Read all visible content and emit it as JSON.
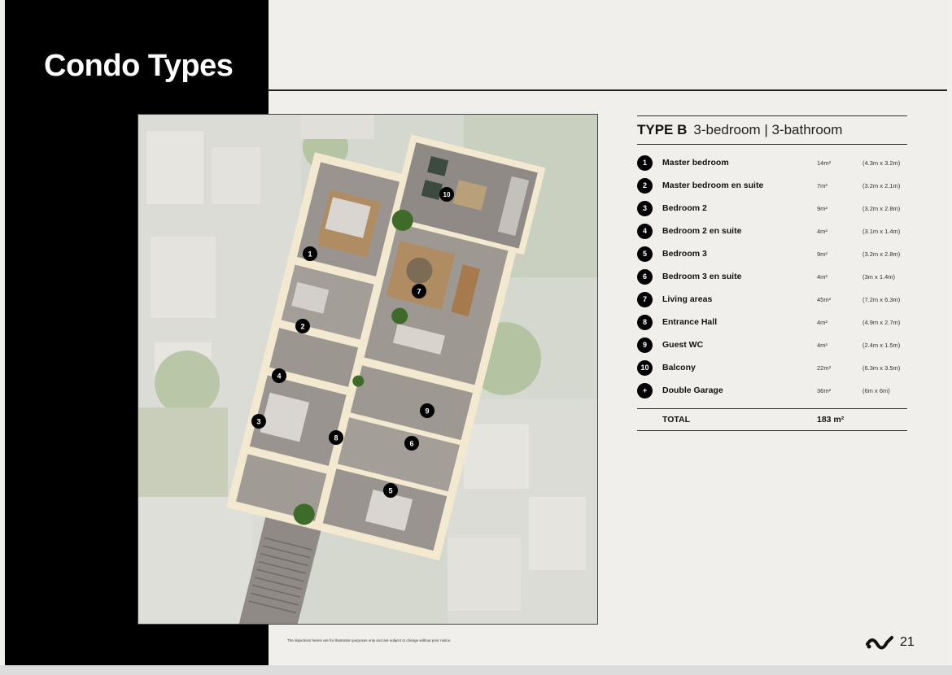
{
  "header": {
    "title": "Condo Types"
  },
  "spec": {
    "type_label": "TYPE B",
    "subtitle": "3-bedroom | 3-bathroom",
    "rows": [
      {
        "badge": "1",
        "name": "Master bedroom",
        "area": "14m²",
        "dims": "(4.3m x 3.2m)"
      },
      {
        "badge": "2",
        "name": "Master bedroom en suite",
        "area": "7m²",
        "dims": "(3.2m x 2.1m)"
      },
      {
        "badge": "3",
        "name": "Bedroom 2",
        "area": "9m²",
        "dims": "(3.2m x 2.8m)"
      },
      {
        "badge": "4",
        "name": "Bedroom 2 en suite",
        "area": "4m²",
        "dims": "(3.1m x 1.4m)"
      },
      {
        "badge": "5",
        "name": "Bedroom 3",
        "area": "9m²",
        "dims": "(3.2m x 2.8m)"
      },
      {
        "badge": "6",
        "name": "Bedroom 3 en suite",
        "area": "4m²",
        "dims": "(3m x 1.4m)"
      },
      {
        "badge": "7",
        "name": "Living areas",
        "area": "45m²",
        "dims": "(7.2m x 6.3m)"
      },
      {
        "badge": "8",
        "name": "Entrance Hall",
        "area": "4m²",
        "dims": "(4.9m x 2.7m)"
      },
      {
        "badge": "9",
        "name": "Guest WC",
        "area": "4m²",
        "dims": "(2.4m x 1.5m)"
      },
      {
        "badge": "10",
        "name": "Balcony",
        "area": "22m²",
        "dims": "(6.3m x 3.5m)"
      },
      {
        "badge": "+",
        "name": "Double Garage",
        "area": "36m²",
        "dims": "(6m x 6m)"
      }
    ],
    "total_label": "TOTAL",
    "total_value": "183 m²"
  },
  "plan": {
    "markers": [
      "1",
      "2",
      "3",
      "4",
      "5",
      "6",
      "7",
      "8",
      "9",
      "10"
    ]
  },
  "footer": {
    "disclaimer": "The depictions herein are for illustration purposes only and are subject to change without prior notice.",
    "page_number": "21"
  },
  "colors": {
    "band": "#000000",
    "page_bg": "#f0efeb",
    "floor": "#9a9490",
    "wall": "#f3e9d0",
    "rug": "#b08c62",
    "plant": "#3f6b2a"
  }
}
